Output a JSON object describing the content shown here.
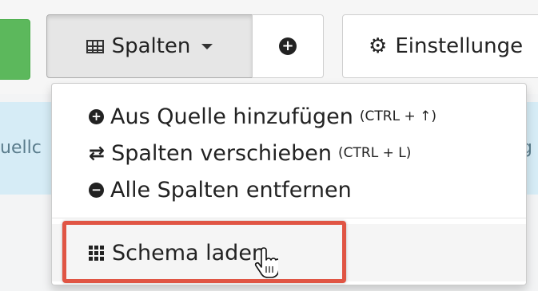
{
  "toolbar": {
    "spalten_label": "Spalten",
    "settings_label": "Einstellunge"
  },
  "background": {
    "left_fragment": "uellc",
    "right_fragment": "g"
  },
  "menu": {
    "items": [
      {
        "label": "Aus Quelle hinzufügen",
        "shortcut": "(CTRL + ↑)",
        "icon": "plus-circle-icon"
      },
      {
        "label": "Spalten verschieben",
        "shortcut": "(CTRL + L)",
        "icon": "exchange-arrows-icon"
      },
      {
        "label": "Alle Spalten entfernen",
        "icon": "minus-circle-icon"
      },
      {
        "label": "Schema laden",
        "icon": "grid-icon"
      }
    ]
  },
  "colors": {
    "primary_green": "#5cb85c",
    "highlight_red": "#e05544",
    "info_band": "#d6ecf6"
  }
}
